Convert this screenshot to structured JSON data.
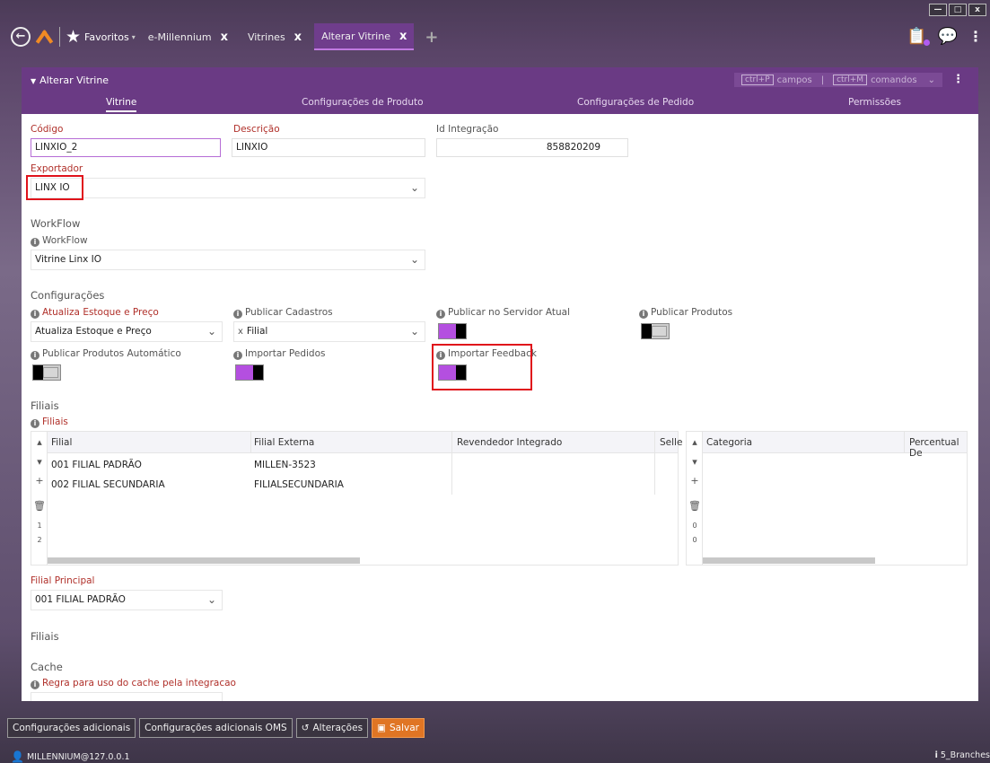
{
  "window": {
    "minimize": "—",
    "maximize": "□",
    "close": "x"
  },
  "topbar": {
    "favorites_label": "Favoritos",
    "tabs": [
      {
        "label": "e-Millennium",
        "close": "x"
      },
      {
        "label": "Vitrines",
        "close": "x"
      },
      {
        "label": "Alterar Vitrine",
        "close": "x"
      }
    ],
    "add_tab": "+"
  },
  "panel": {
    "title": "Alterar Vitrine",
    "shortcut_fields_key": "ctrl+P",
    "shortcut_fields_label": "campos",
    "shortcut_divider": "|",
    "shortcut_commands_key": "ctrl+M",
    "shortcut_commands_label": "comandos",
    "tabs": [
      "Vitrine",
      "Configurações de Produto",
      "Configurações de Pedido",
      "Permissões"
    ]
  },
  "form": {
    "codigo_label": "Código",
    "codigo_value": "LINXIO_2",
    "descricao_label": "Descrição",
    "descricao_value": "LINXIO",
    "id_integracao_label": "Id Integração",
    "id_integracao_value": "858820209",
    "exportador_label": "Exportador",
    "exportador_value": "LINX IO",
    "workflow_section": "WorkFlow",
    "workflow_label": "WorkFlow",
    "workflow_value": "Vitrine Linx IO",
    "config_section": "Configurações",
    "atualiza_label": "Atualiza Estoque e Preço",
    "atualiza_value": "Atualiza Estoque e Preço",
    "publicar_cadastros_label": "Publicar Cadastros",
    "publicar_cadastros_chip": "Filial",
    "publicar_servidor_label": "Publicar no Servidor Atual",
    "publicar_servidor_on": true,
    "publicar_produtos_label": "Publicar Produtos",
    "publicar_produtos_on": false,
    "publicar_auto_label": "Publicar Produtos Automático",
    "publicar_auto_on": false,
    "importar_pedidos_label": "Importar Pedidos",
    "importar_pedidos_on": true,
    "importar_feedback_label": "Importar Feedback",
    "importar_feedback_on": true,
    "filiais_section": "Filiais",
    "filiais_label": "Filiais",
    "filial_principal_label": "Filial Principal",
    "filial_principal_value": "001 FILIAL PADRÃO",
    "filiais_section2": "Filiais",
    "cache_section": "Cache",
    "cache_label": "Regra para uso do cache pela integracao"
  },
  "grid_filiais": {
    "columns": [
      "Filial",
      "Filial Externa",
      "Revendedor Integrado",
      "Selle"
    ],
    "rows": [
      [
        "001 FILIAL PADRÃO",
        "MILLEN-3523"
      ],
      [
        "002 FILIAL SECUNDARIA",
        "FILIALSECUNDARIA"
      ]
    ],
    "row_numbers": [
      "1",
      "2"
    ]
  },
  "grid_categoria": {
    "columns": [
      "Categoria",
      "Percentual De"
    ],
    "row_numbers": [
      "0",
      "0"
    ]
  },
  "bottom": {
    "btn_config": "Configurações adicionais",
    "btn_config_oms": "Configurações adicionais OMS",
    "btn_alteracoes": "Alterações",
    "btn_salvar": "Salvar",
    "user": "MILLENNIUM@127.0.0.1",
    "branches": "5_Branches"
  },
  "colors": {
    "accent": "#6a3a84",
    "toggle_on": "#b44fe0",
    "save": "#e07524",
    "required": "#b0302a",
    "highlight": "#e0121b"
  }
}
